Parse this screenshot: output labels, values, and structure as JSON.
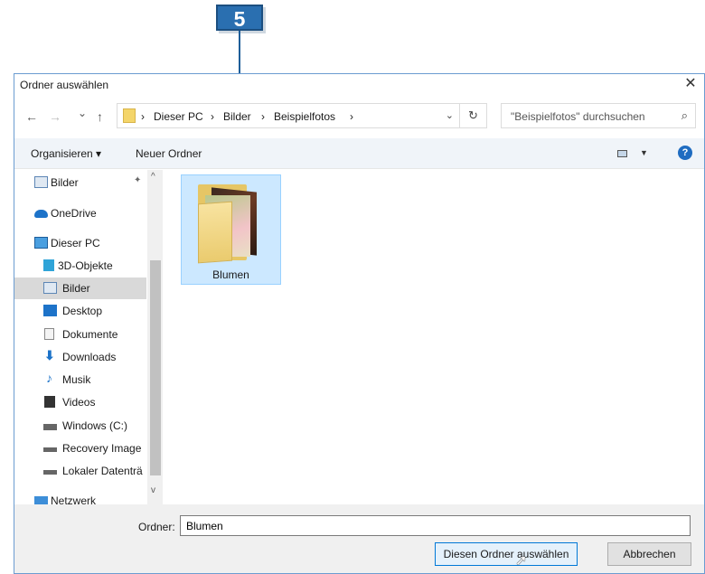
{
  "callout": {
    "number": "5"
  },
  "dialog": {
    "title": "Ordner auswählen",
    "close_glyph": "✕"
  },
  "nav": {
    "back_glyph": "←",
    "forward_glyph": "→",
    "recent_glyph": "⌄",
    "up_glyph": "↑",
    "breadcrumbs": [
      "Dieser PC",
      "Bilder",
      "Beispielfotos"
    ],
    "separator": "›",
    "dropdown_glyph": "⌄",
    "refresh_glyph": "↻",
    "search_placeholder": "\"Beispielfotos\" durchsuchen",
    "search_glyph": "⌕"
  },
  "toolbar": {
    "organize": "Organisieren ▾",
    "new_folder": "Neuer Ordner",
    "view_drop": "▼",
    "help": "?"
  },
  "sidebar": {
    "items": [
      {
        "label": "Bilder",
        "icon": "pictures-icon",
        "pinned": true
      },
      {
        "label": "OneDrive",
        "icon": "onedrive-icon"
      },
      {
        "label": "Dieser PC",
        "icon": "computer-icon"
      },
      {
        "label": "3D-Objekte",
        "icon": "3d-objects-icon"
      },
      {
        "label": "Bilder",
        "icon": "pictures-icon",
        "selected": true
      },
      {
        "label": "Desktop",
        "icon": "desktop-icon"
      },
      {
        "label": "Dokumente",
        "icon": "documents-icon"
      },
      {
        "label": "Downloads",
        "icon": "downloads-icon"
      },
      {
        "label": "Musik",
        "icon": "music-icon"
      },
      {
        "label": "Videos",
        "icon": "videos-icon"
      },
      {
        "label": "Windows (C:)",
        "icon": "drive-icon"
      },
      {
        "label": "Recovery Image",
        "icon": "drive-icon"
      },
      {
        "label": "Lokaler Datenträ",
        "icon": "drive-icon"
      },
      {
        "label": "Netzwerk",
        "icon": "network-icon"
      }
    ],
    "pin_glyph": "📌",
    "scroll_up": "^",
    "scroll_down": "v"
  },
  "content": {
    "folder_name": "Blumen"
  },
  "footer": {
    "folder_label": "Ordner:",
    "folder_value": "Blumen",
    "select_button": "Diesen Ordner auswählen",
    "cancel_button": "Abbrechen"
  },
  "colors": {
    "accent": "#0078d7",
    "callout": "#2a6fb0",
    "selection": "#cce8ff"
  }
}
